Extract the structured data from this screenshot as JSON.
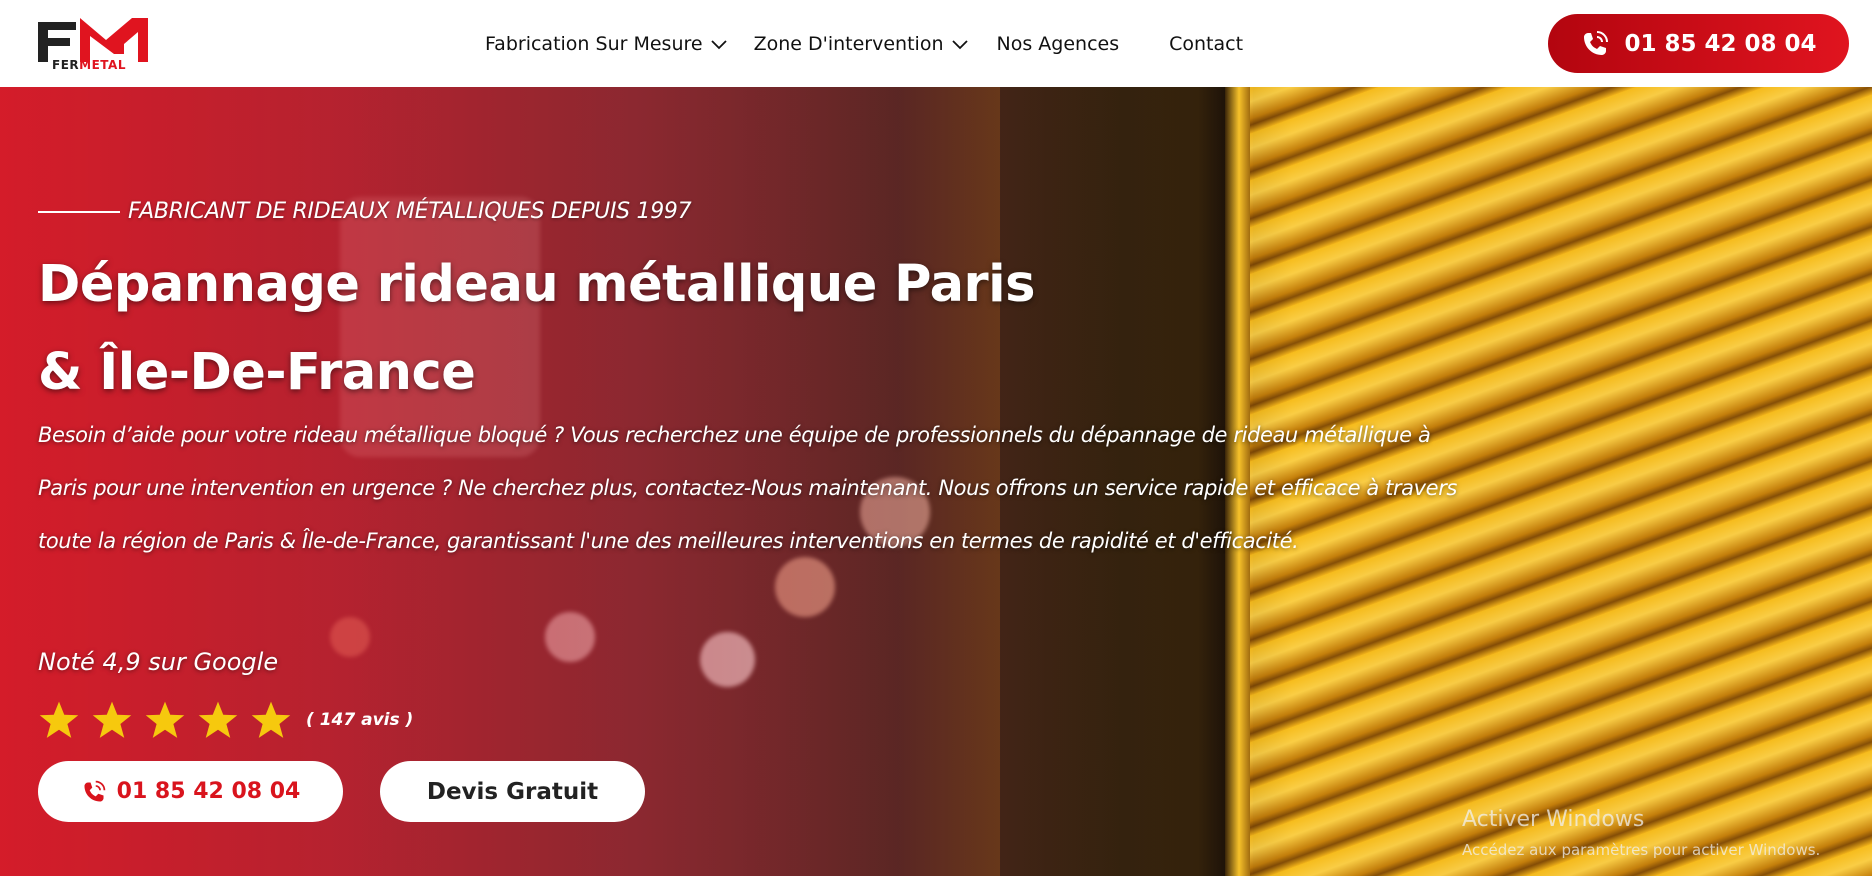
{
  "header": {
    "logo_text_fer": "FER",
    "logo_text_metal": "METAL",
    "nav": [
      {
        "label": "Fabrication Sur Mesure",
        "has_dropdown": true
      },
      {
        "label": "Zone D'intervention",
        "has_dropdown": true
      },
      {
        "label": "Nos Agences",
        "has_dropdown": false
      },
      {
        "label": "Contact",
        "has_dropdown": false
      }
    ],
    "phone": "01 85 42 08 04"
  },
  "hero": {
    "tagline": "FABRICANT DE RIDEAUX MÉTALLIQUES DEPUIS 1997",
    "title_line1": "Dépannage rideau métallique Paris",
    "title_line2": "& Île-De-France",
    "intro": "Besoin d’aide pour votre rideau métallique bloqué ? Vous recherchez une équipe de professionnels du dépannage de rideau métallique à Paris pour une intervention en urgence ? Ne cherchez plus, contactez-Nous maintenant. Nous offrons un service rapide et efficace à travers toute la région de Paris & Île-de-France, garantissant l'une des meilleures interventions en termes de rapidité et d'efficacité.",
    "rating_text": "Noté 4,9 sur Google",
    "stars": 5,
    "review_count": "( 147 avis )",
    "phone_button": "01 85 42 08 04",
    "quote_button": "Devis Gratuit"
  },
  "watermark": {
    "title": "Activer Windows",
    "subtitle": "Accédez aux paramètres pour activer Windows."
  },
  "colors": {
    "brand_red": "#e0141f",
    "star_yellow": "#f6c90e"
  }
}
